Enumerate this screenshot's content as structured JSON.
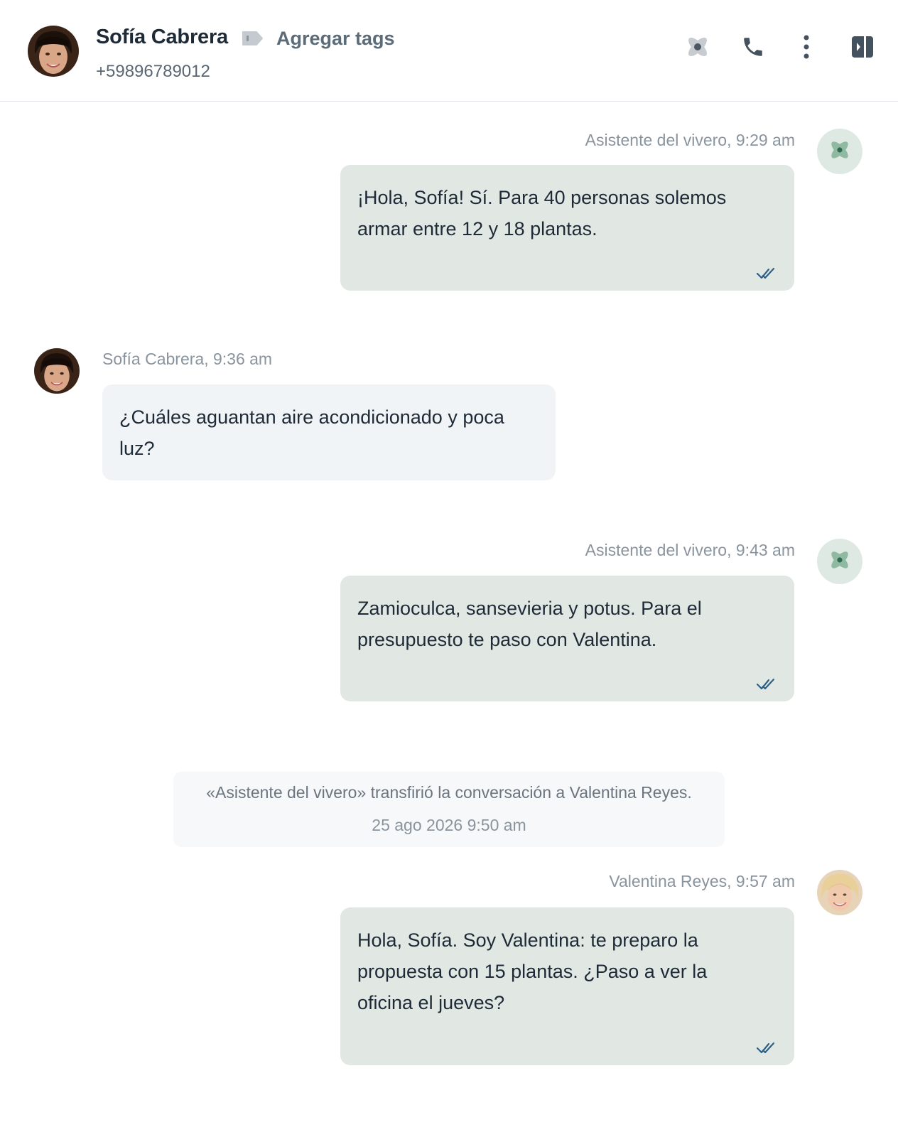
{
  "contact": {
    "name": "Sofía Cabrera",
    "phone": "+59896789012",
    "add_tags_label": "Agregar tags"
  },
  "header_actions": {
    "icons": [
      "bot-icon",
      "phone-icon",
      "more-vertical-icon",
      "sidebar-toggle-icon"
    ]
  },
  "messages": [
    {
      "author": "Asistente del vivero",
      "meta": "Asistente del vivero, 9:29 am",
      "text": "¡Hola, Sofía! Sí. Para 40 personas solemos armar entre 12 y 18 plantas.",
      "direction": "out",
      "status_icon": "double-check-icon"
    },
    {
      "author": "Sofía Cabrera",
      "meta": "Sofía Cabrera, 9:36 am",
      "text": "¿Cuáles aguantan aire acondicionado y poca luz?",
      "direction": "in"
    },
    {
      "author": "Asistente del vivero",
      "meta": "Asistente del vivero, 9:43 am",
      "text": "Zamioculca, sansevieria y potus. Para el presupuesto te paso con Valentina.",
      "direction": "out",
      "status_icon": "double-check-icon"
    },
    {
      "author": "Valentina Reyes",
      "meta": "Valentina Reyes, 9:57 am",
      "text": "Hola, Sofía. Soy Valentina: te preparo la propuesta con 15 plantas. ¿Paso a ver la oficina el jueves?",
      "direction": "out",
      "status_icon": "double-check-icon"
    }
  ],
  "system_note": {
    "text": "«Asistente del vivero» transfirió la conversación a Valentina Reyes.",
    "timestamp": "25 ago 2026 9:50 am"
  },
  "colors": {
    "accent_green": "#2f6b4f",
    "outgoing_bubble": "#e1e8e4",
    "incoming_bubble": "#f1f4f6",
    "check_blue": "#2f5f86"
  }
}
